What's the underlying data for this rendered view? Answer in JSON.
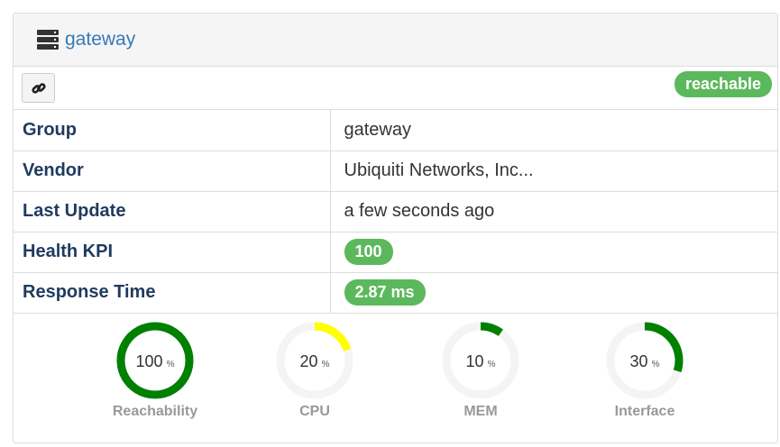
{
  "header": {
    "title": "gateway",
    "icon": "server-icon"
  },
  "toolbar": {
    "link_icon": "link-icon",
    "status": "reachable"
  },
  "rows": [
    {
      "key": "Group",
      "value": "gateway",
      "badge": false
    },
    {
      "key": "Vendor",
      "value": "Ubiquiti Networks, Inc...",
      "badge": false
    },
    {
      "key": "Last Update",
      "value": "a few seconds ago",
      "badge": false
    },
    {
      "key": "Health KPI",
      "value": "100",
      "badge": true
    },
    {
      "key": "Response Time",
      "value": "2.87 ms",
      "badge": true
    }
  ],
  "gauges": [
    {
      "label": "Reachability",
      "value": 100,
      "unit": "%",
      "color": "#008000"
    },
    {
      "label": "CPU",
      "value": 20,
      "unit": "%",
      "color": "#ffff00"
    },
    {
      "label": "MEM",
      "value": 10,
      "unit": "%",
      "color": "#008000"
    },
    {
      "label": "Interface",
      "value": 30,
      "unit": "%",
      "color": "#008000"
    }
  ],
  "colors": {
    "accent": "#337ab7",
    "success": "#5cb85c",
    "track": "#f4f4f4"
  }
}
